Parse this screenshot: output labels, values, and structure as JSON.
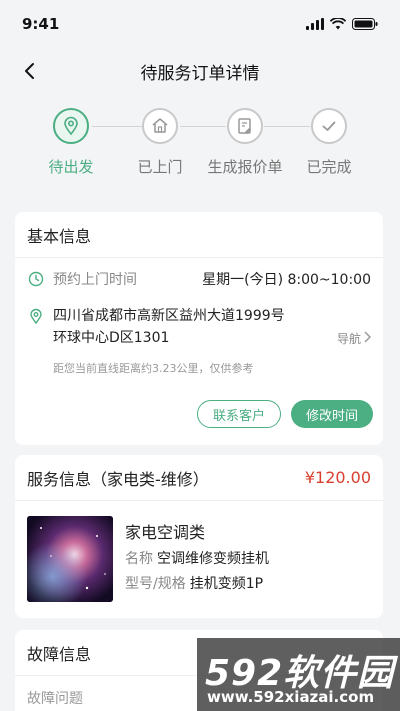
{
  "status_bar": {
    "time": "9:41",
    "icons": [
      "signal-icon",
      "wifi-icon",
      "battery-icon"
    ]
  },
  "nav": {
    "title": "待服务订单详情",
    "back_icon": "back-arrow-icon"
  },
  "steps": [
    {
      "label": "待出发",
      "icon": "location-pin-icon",
      "active": true
    },
    {
      "label": "已上门",
      "icon": "home-icon",
      "active": false
    },
    {
      "label": "生成报价单",
      "icon": "quote-document-icon",
      "active": false
    },
    {
      "label": "已完成",
      "icon": "check-circle-icon",
      "active": false
    }
  ],
  "basic_info": {
    "title": "基本信息",
    "appointment_label": "预约上门时间",
    "appointment_value": "星期一(今日)  8:00~10:00",
    "address_line1": "四川省成都市高新区益州大道1999号",
    "address_line2": "环球中心D区1301",
    "nav_link": "导航",
    "distance_hint": "距您当前直线距离约3.23公里，仅供参考",
    "contact_button": "联系客户",
    "change_time_button": "修改时间"
  },
  "service_info": {
    "title": "服务信息（家电类-维修）",
    "price": "¥120.00",
    "category": "家电空调类",
    "name_key": "名称",
    "name_value": "空调维修变频挂机",
    "model_key": "型号/规格",
    "model_value": "挂机变频1P"
  },
  "fault_info": {
    "title": "故障信息",
    "problem_label": "故障问题"
  },
  "watermark": {
    "logo": "592软件园",
    "url": "www.592xiazai.com"
  },
  "colors": {
    "accent": "#4cae83",
    "price": "#d9402f",
    "background": "#f3f4f6"
  }
}
